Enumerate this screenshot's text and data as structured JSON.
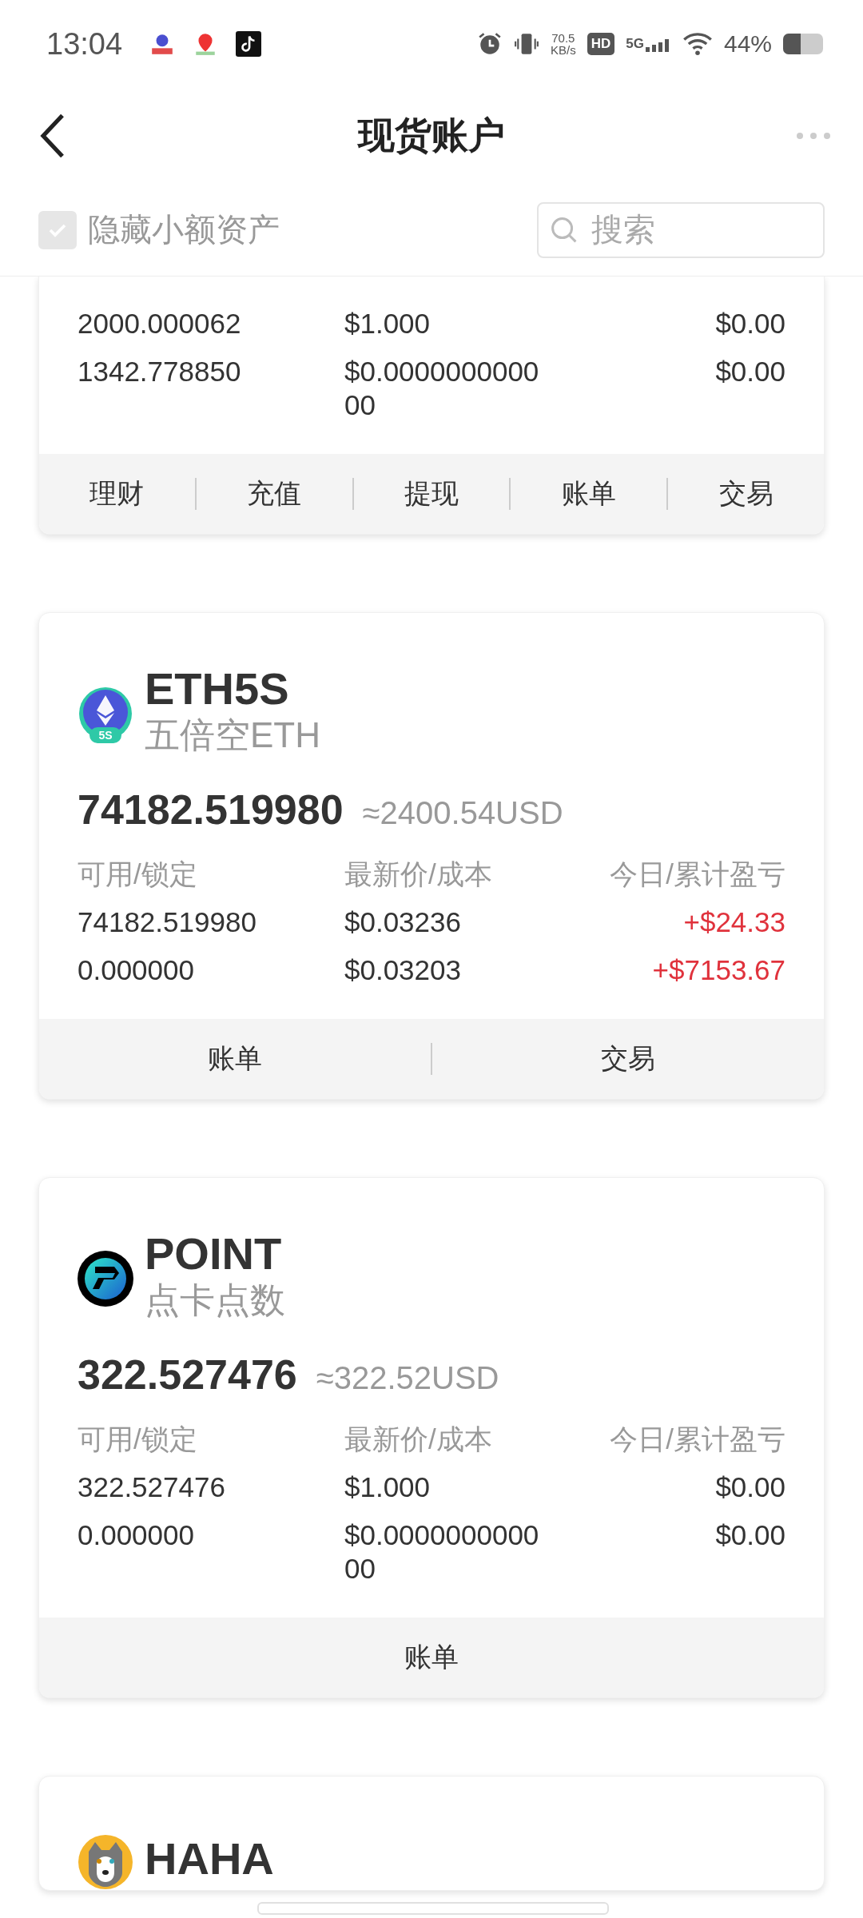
{
  "status_bar": {
    "time": "13:04",
    "speed_value": "70.5",
    "speed_unit": "KB/s",
    "hd": "HD",
    "network": "5G",
    "battery": "44%"
  },
  "header": {
    "title": "现货账户"
  },
  "filter": {
    "hide_small": {
      "label": "隐藏小额资产",
      "checked": true
    },
    "search": {
      "placeholder": "搜索"
    }
  },
  "accounts": [
    {
      "partial": true,
      "rows": [
        {
          "available": "2000.000062",
          "price": "$1.000",
          "pnl": "$0.00",
          "gain": false
        },
        {
          "available": "1342.778850",
          "price": "$0.000000000000",
          "pnl": "$0.00",
          "gain": false
        }
      ],
      "actions": [
        "理财",
        "充值",
        "提现",
        "账单",
        "交易"
      ]
    },
    {
      "partial": false,
      "kind": "eth5s",
      "logo_badge": "5S",
      "symbol": "ETH5S",
      "name": "五倍空ETH",
      "balance": "74182.519980",
      "usd": "≈2400.54USD",
      "labels": [
        "可用/锁定",
        "最新价/成本",
        "今日/累计盈亏"
      ],
      "rows": [
        {
          "available": "74182.519980",
          "price": "$0.03236",
          "pnl": "+$24.33",
          "gain": true
        },
        {
          "available": "0.000000",
          "price": "$0.03203",
          "pnl": "+$7153.67",
          "gain": true
        }
      ],
      "actions": [
        "账单",
        "交易"
      ]
    },
    {
      "partial": false,
      "kind": "point",
      "symbol": "POINT",
      "name": "点卡点数",
      "balance": "322.527476",
      "usd": "≈322.52USD",
      "labels": [
        "可用/锁定",
        "最新价/成本",
        "今日/累计盈亏"
      ],
      "rows": [
        {
          "available": "322.527476",
          "price": "$1.000",
          "pnl": "$0.00",
          "gain": false
        },
        {
          "available": "0.000000",
          "price": "$0.000000000000",
          "pnl": "$0.00",
          "gain": false
        }
      ],
      "actions": [
        "账单"
      ]
    },
    {
      "partial": false,
      "kind": "dog",
      "symbol": "HAHA"
    }
  ]
}
